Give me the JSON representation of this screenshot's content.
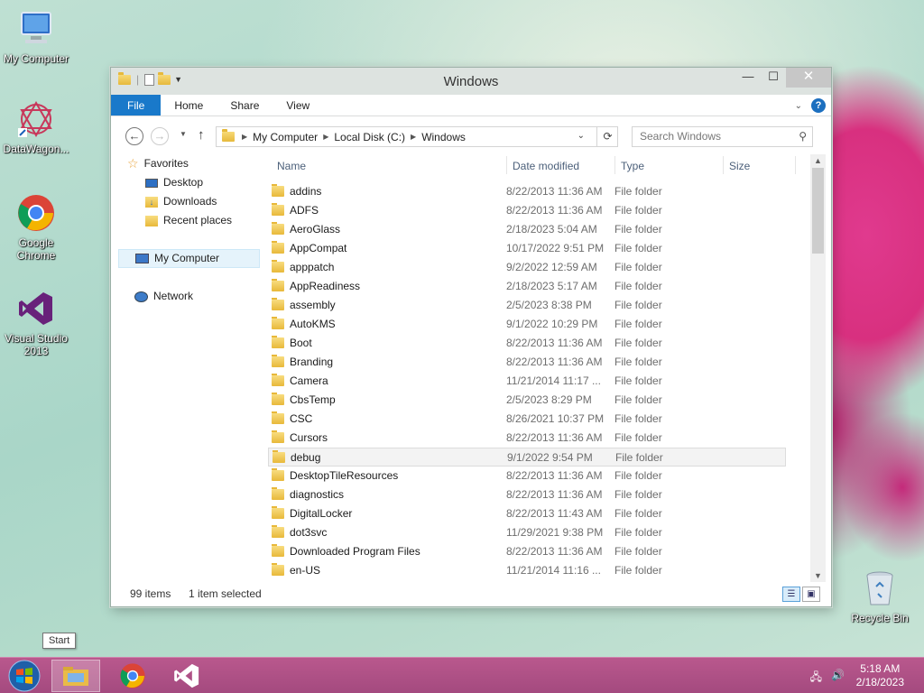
{
  "desktop": {
    "icons": [
      {
        "label": "My Computer",
        "icon": "my-computer-icon"
      },
      {
        "label": "DataWagon...",
        "icon": "datawagon-icon"
      },
      {
        "label": "Google Chrome",
        "icon": "chrome-icon"
      },
      {
        "label": "Visual Studio 2013",
        "icon": "visual-studio-icon"
      },
      {
        "label": "Recycle Bin",
        "icon": "recycle-bin-icon"
      }
    ]
  },
  "window": {
    "title": "Windows",
    "controls": {
      "minimize": "—",
      "maximize": "☐",
      "close": "✕"
    },
    "ribbon": {
      "tabs": [
        "File",
        "Home",
        "Share",
        "View"
      ],
      "help": "?"
    },
    "nav": {
      "back": "←",
      "forward": "→",
      "up": "↑",
      "breadcrumb": [
        "My Computer",
        "Local Disk (C:)",
        "Windows"
      ],
      "search_placeholder": "Search Windows"
    },
    "navpane": {
      "favorites_label": "Favorites",
      "favorites": [
        "Desktop",
        "Downloads",
        "Recent places"
      ],
      "my_computer": "My Computer",
      "network": "Network"
    },
    "columns": [
      "Name",
      "Date modified",
      "Type",
      "Size"
    ],
    "files": [
      {
        "name": "addins",
        "date": "8/22/2013 11:36 AM",
        "type": "File folder"
      },
      {
        "name": "ADFS",
        "date": "8/22/2013 11:36 AM",
        "type": "File folder"
      },
      {
        "name": "AeroGlass",
        "date": "2/18/2023 5:04 AM",
        "type": "File folder"
      },
      {
        "name": "AppCompat",
        "date": "10/17/2022 9:51 PM",
        "type": "File folder"
      },
      {
        "name": "apppatch",
        "date": "9/2/2022 12:59 AM",
        "type": "File folder"
      },
      {
        "name": "AppReadiness",
        "date": "2/18/2023 5:17 AM",
        "type": "File folder"
      },
      {
        "name": "assembly",
        "date": "2/5/2023 8:38 PM",
        "type": "File folder"
      },
      {
        "name": "AutoKMS",
        "date": "9/1/2022 10:29 PM",
        "type": "File folder"
      },
      {
        "name": "Boot",
        "date": "8/22/2013 11:36 AM",
        "type": "File folder"
      },
      {
        "name": "Branding",
        "date": "8/22/2013 11:36 AM",
        "type": "File folder"
      },
      {
        "name": "Camera",
        "date": "11/21/2014 11:17 ...",
        "type": "File folder"
      },
      {
        "name": "CbsTemp",
        "date": "2/5/2023 8:29 PM",
        "type": "File folder"
      },
      {
        "name": "CSC",
        "date": "8/26/2021 10:37 PM",
        "type": "File folder"
      },
      {
        "name": "Cursors",
        "date": "8/22/2013 11:36 AM",
        "type": "File folder"
      },
      {
        "name": "debug",
        "date": "9/1/2022 9:54 PM",
        "type": "File folder"
      },
      {
        "name": "DesktopTileResources",
        "date": "8/22/2013 11:36 AM",
        "type": "File folder"
      },
      {
        "name": "diagnostics",
        "date": "8/22/2013 11:36 AM",
        "type": "File folder"
      },
      {
        "name": "DigitalLocker",
        "date": "8/22/2013 11:43 AM",
        "type": "File folder"
      },
      {
        "name": "dot3svc",
        "date": "11/29/2021 9:38 PM",
        "type": "File folder"
      },
      {
        "name": "Downloaded Program Files",
        "date": "8/22/2013 11:36 AM",
        "type": "File folder"
      },
      {
        "name": "en-US",
        "date": "11/21/2014 11:16 ...",
        "type": "File folder"
      }
    ],
    "highlighted_file": "debug",
    "status": {
      "count": "99 items",
      "selection": "1 item selected"
    }
  },
  "taskbar": {
    "start_tooltip": "Start",
    "apps": [
      "file-explorer-icon",
      "chrome-icon",
      "visual-studio-icon"
    ],
    "time": "5:18 AM",
    "date": "2/18/2023"
  },
  "colors": {
    "accent": "#1979ca",
    "taskbar": "#a94d83"
  }
}
